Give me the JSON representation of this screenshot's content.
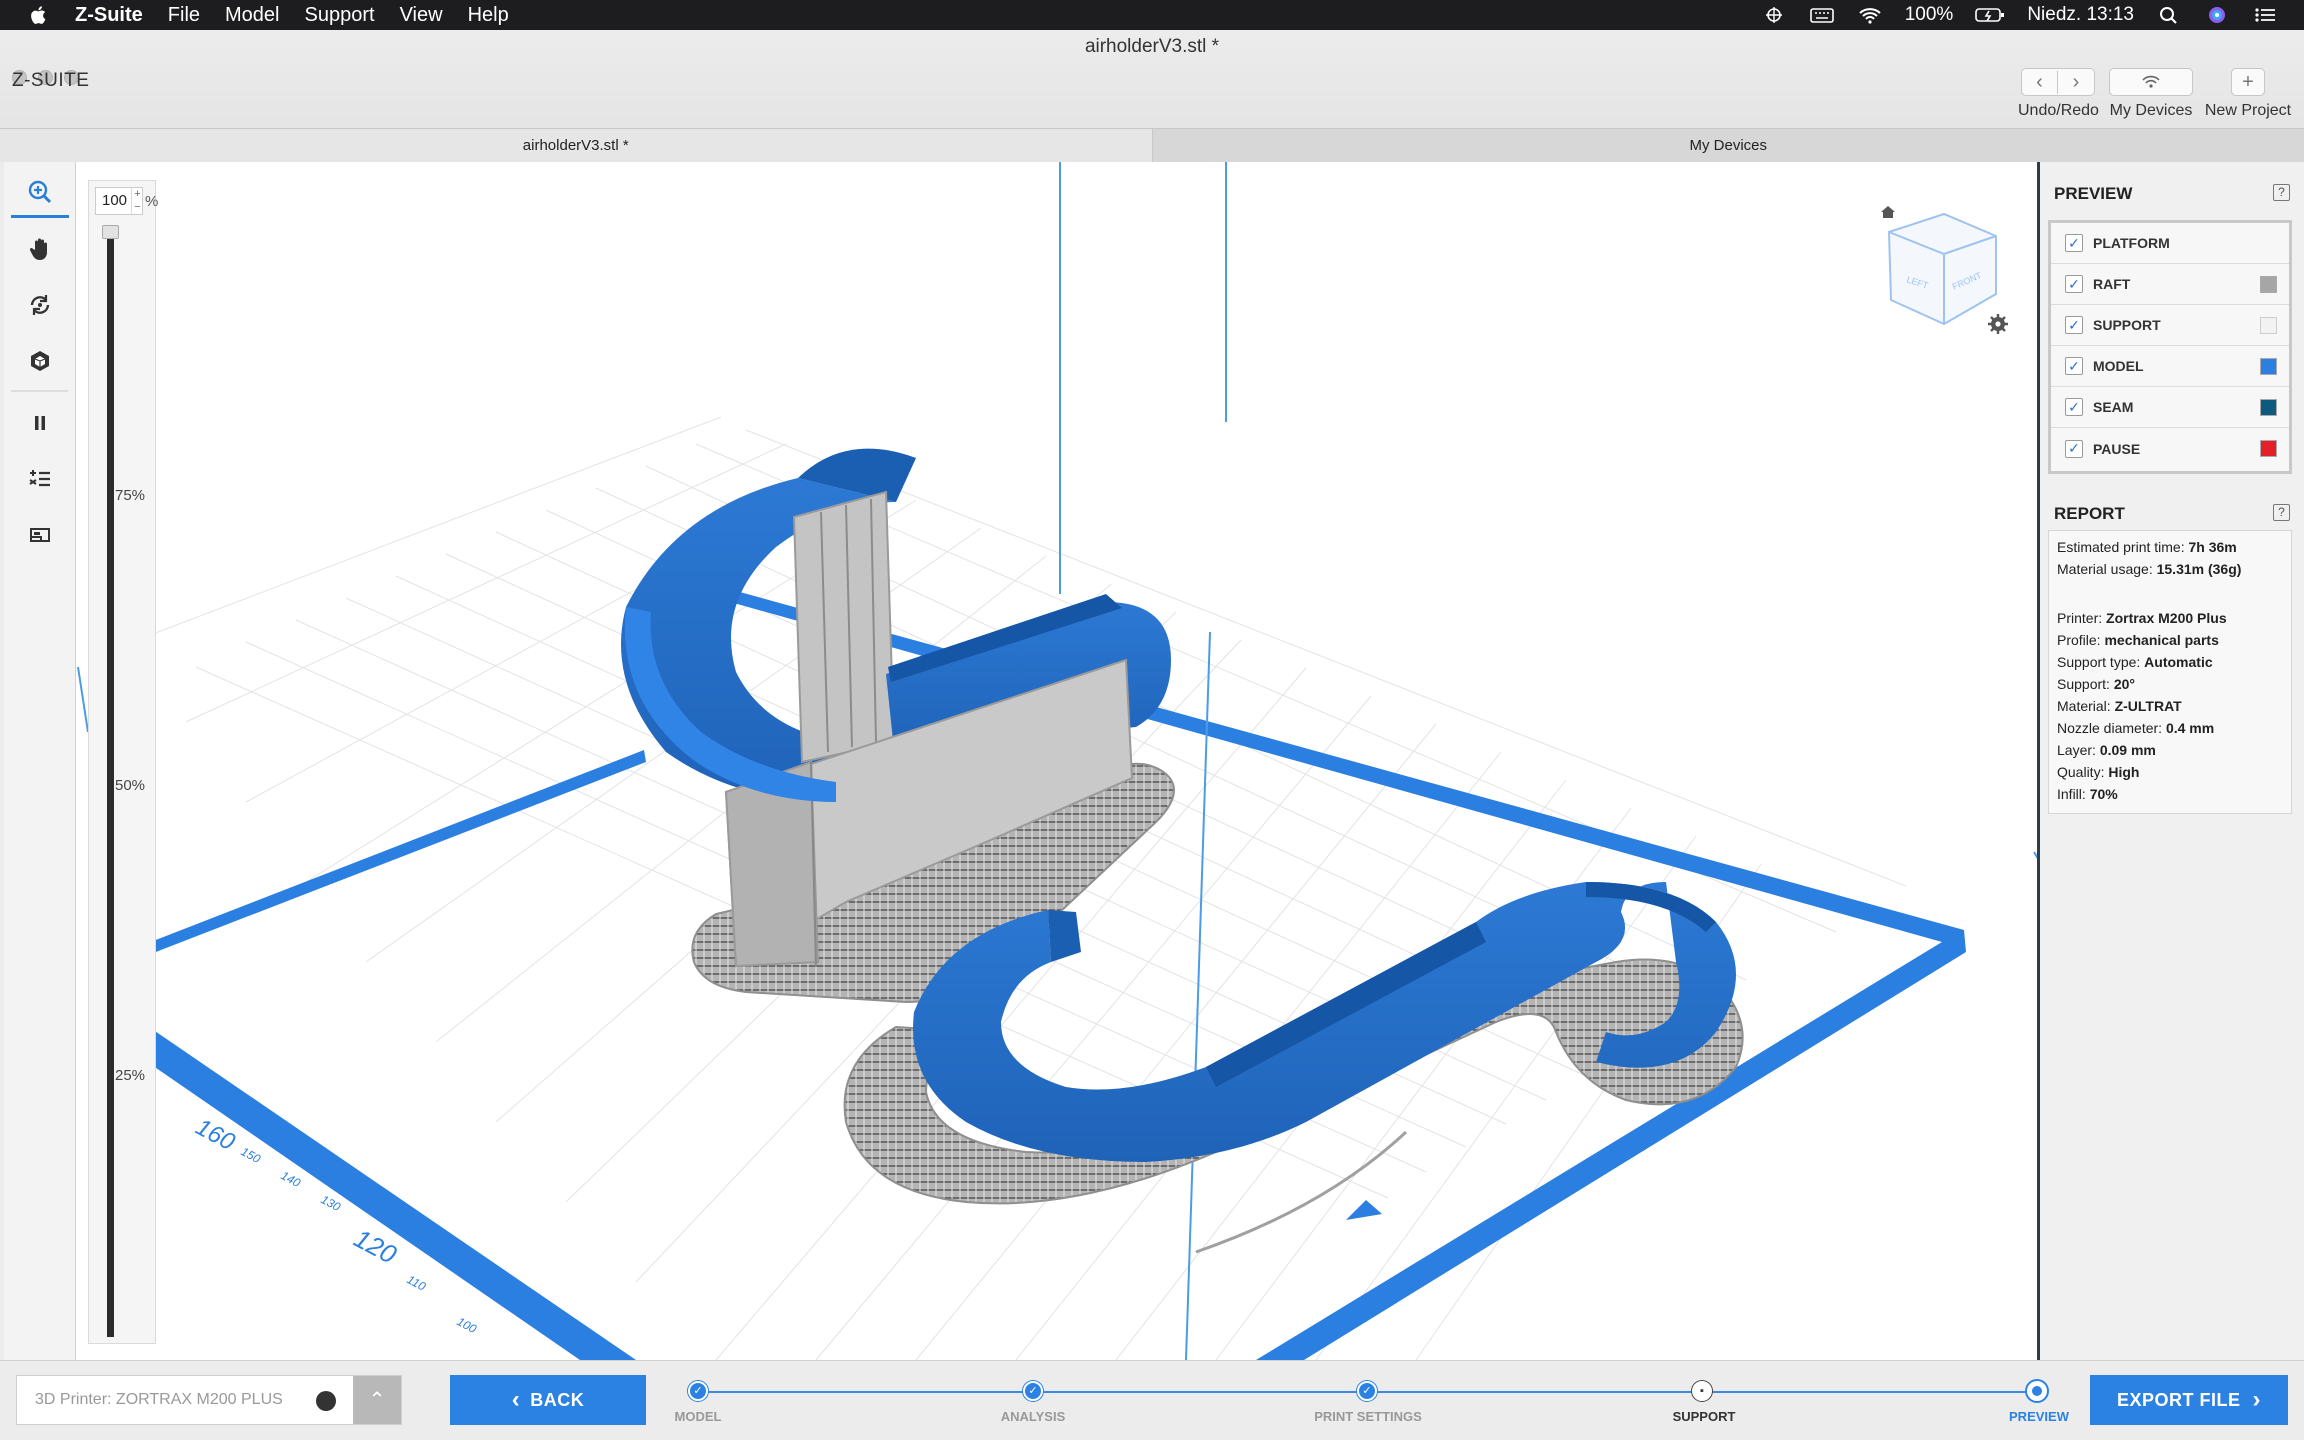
{
  "menubar": {
    "app_name": "Z-Suite",
    "items": [
      "File",
      "Model",
      "Support",
      "View",
      "Help"
    ],
    "battery": "100%",
    "clock": "Niedz. 13:13"
  },
  "window": {
    "title": "airholderV3.stl *",
    "logo": "Z-SUITE"
  },
  "toolbar": {
    "undo_redo_label": "Undo/Redo",
    "my_devices_label": "My Devices",
    "new_project_label": "New Project"
  },
  "tabs": [
    {
      "label": "airholderV3.stl *",
      "active": true
    },
    {
      "label": "My Devices",
      "active": false
    }
  ],
  "tools": [
    "zoom-icon",
    "hand-icon",
    "rotate-icon",
    "cube-icon",
    "pause-icon",
    "layers-list-icon",
    "layer-view-icon"
  ],
  "zoom": {
    "value": "100",
    "unit": "%",
    "level_fraction": 1.0,
    "marks": [
      "75%",
      "50%",
      "25%"
    ]
  },
  "view_cube": {
    "left_label": "LEFT",
    "front_label": "FRONT"
  },
  "axis_labels": [
    "160",
    "150",
    "140",
    "130",
    "120",
    "110",
    "100"
  ],
  "preview": {
    "title": "PREVIEW",
    "help": "?",
    "layers": [
      {
        "label": "PLATFORM",
        "checked": true,
        "color": null
      },
      {
        "label": "RAFT",
        "checked": true,
        "color": "#a6a6a6"
      },
      {
        "label": "SUPPORT",
        "checked": true,
        "color": "#f2f2f2"
      },
      {
        "label": "MODEL",
        "checked": true,
        "color": "#2b7fe0"
      },
      {
        "label": "SEAM",
        "checked": true,
        "color": "#0d5a80"
      },
      {
        "label": "PAUSE",
        "checked": true,
        "color": "#e3202a"
      }
    ]
  },
  "report": {
    "title": "REPORT",
    "help": "?",
    "print_time_label": "Estimated print time:",
    "print_time": "7h 36m",
    "material_usage_label": "Material usage:",
    "material_usage": "15.31m (36g)",
    "details": [
      {
        "label": "Printer:",
        "value": "Zortrax M200 Plus"
      },
      {
        "label": "Profile:",
        "value": "mechanical parts"
      },
      {
        "label": "Support type:",
        "value": "Automatic"
      },
      {
        "label": "Support:",
        "value": "20°"
      },
      {
        "label": "Material:",
        "value": "Z-ULTRAT"
      },
      {
        "label": "Nozzle diameter:",
        "value": "0.4 mm"
      },
      {
        "label": "Layer:",
        "value": "0.09 mm"
      },
      {
        "label": "Quality:",
        "value": "High"
      },
      {
        "label": "Infill:",
        "value": "70%"
      }
    ]
  },
  "bottom": {
    "printer_placeholder": "3D Printer:",
    "printer_value": "ZORTRAX M200 PLUS",
    "back_label": "BACK",
    "export_label": "EXPORT FILE",
    "steps": [
      {
        "label": "MODEL",
        "state": "done"
      },
      {
        "label": "ANALYSIS",
        "state": "done"
      },
      {
        "label": "PRINT SETTINGS",
        "state": "done"
      },
      {
        "label": "SUPPORT",
        "state": "locked"
      },
      {
        "label": "PREVIEW",
        "state": "current"
      }
    ]
  },
  "colors": {
    "accent": "#2b82e3",
    "model": "#2b7fe0",
    "raft": "#a6a6a6"
  }
}
